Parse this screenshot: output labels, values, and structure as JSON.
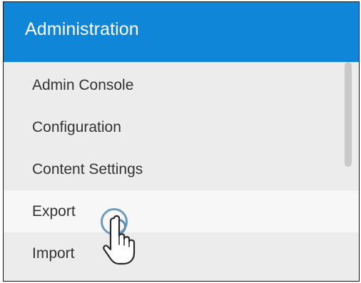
{
  "header": {
    "title": "Administration"
  },
  "menu": {
    "items": [
      {
        "label": "Admin Console"
      },
      {
        "label": "Configuration"
      },
      {
        "label": "Content Settings"
      },
      {
        "label": "Export",
        "state": "hovered"
      },
      {
        "label": "Import"
      }
    ]
  },
  "colors": {
    "header_background": "#0f86d8",
    "menu_background": "#ececec",
    "hover_background": "#f7f7f7",
    "text": "#333333"
  },
  "icons": {
    "cursor": "hand-pointer-icon",
    "click_indicator": "click-ripple-icon"
  }
}
